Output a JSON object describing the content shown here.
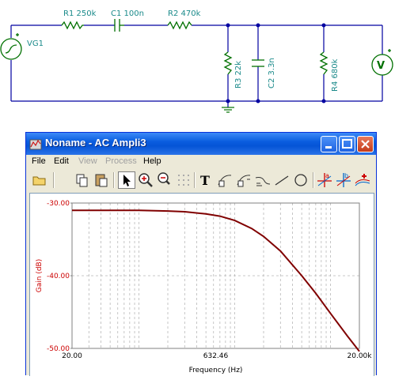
{
  "schematic": {
    "source_label": "VG1",
    "components": [
      {
        "name": "R1",
        "value": "250k",
        "label": "R1 250k"
      },
      {
        "name": "C1",
        "value": "100n",
        "label": "C1 100n"
      },
      {
        "name": "R2",
        "value": "470k",
        "label": "R2 470k"
      },
      {
        "name": "R3",
        "value": "22k",
        "label": "R3 22k"
      },
      {
        "name": "C2",
        "value": "3.3n",
        "label": "C2 3.3n"
      },
      {
        "name": "R4",
        "value": "680k",
        "label": "R4 680k"
      }
    ],
    "meter_symbol": "V",
    "plus_sign": "+"
  },
  "window": {
    "title": "Noname - AC Ampli3",
    "menu": [
      "File",
      "Edit",
      "View",
      "Process",
      "Help"
    ],
    "menu_disabled": [
      "View",
      "Process"
    ],
    "toolbar_icons": [
      "open-folder-icon",
      "copy-icon",
      "paste-icon",
      "pointer-icon",
      "zoom-in-icon",
      "zoom-100-icon",
      "grid-icon",
      "text-tool-icon",
      "curve-tool-1-icon",
      "curve-tool-2-icon",
      "curve-tool-3-icon",
      "line-tool-icon",
      "circle-tool-icon",
      "cursor-a-icon",
      "cursor-b-icon",
      "add-trace-icon"
    ],
    "colors": {
      "curve": "#800000",
      "axis_text": "#cc0000",
      "x_axis_text": "#000000",
      "grid": "#b8b8b8"
    }
  },
  "chart_data": {
    "type": "line",
    "xlabel": "Frequency (Hz)",
    "ylabel": "Gain (dB)",
    "xscale": "log",
    "xlim": [
      20,
      20000
    ],
    "ylim": [
      -50,
      -30
    ],
    "xticks": [
      "20.00",
      "632.46",
      "20.00k"
    ],
    "yticks": [
      "-30.00",
      "-40.00",
      "-50.00"
    ],
    "grid": true,
    "series": [
      {
        "x": [
          20,
          50,
          100,
          200,
          300,
          500,
          700,
          1000,
          1500,
          2000,
          3000,
          5000,
          7000,
          10000,
          15000,
          20000
        ],
        "values": [
          -31.0,
          -31.0,
          -31.0,
          -31.1,
          -31.2,
          -31.5,
          -31.8,
          -32.4,
          -33.5,
          -34.6,
          -36.6,
          -40.0,
          -42.4,
          -45.2,
          -48.3,
          -50.4
        ]
      }
    ]
  }
}
